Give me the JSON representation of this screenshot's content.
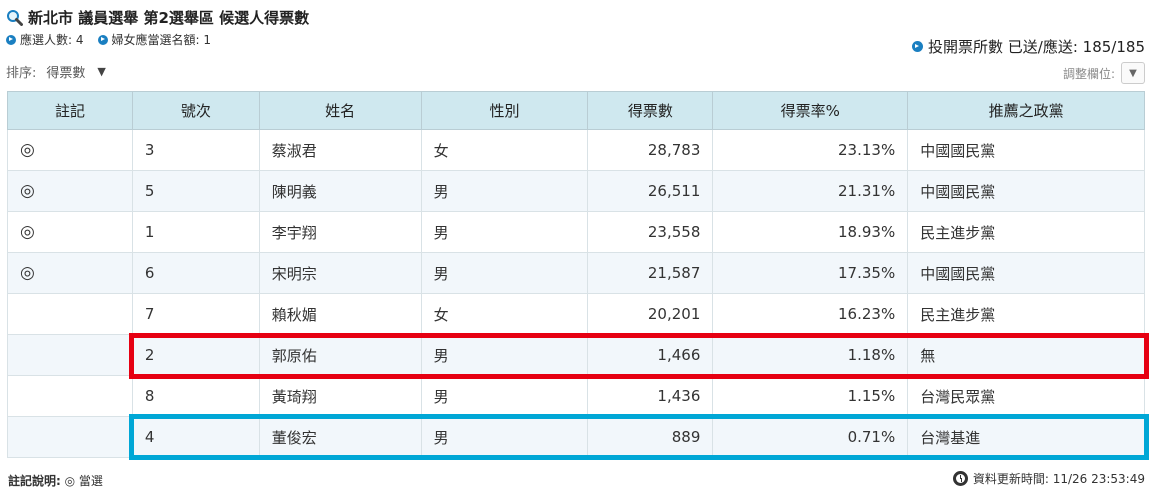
{
  "header": {
    "title": "新北市 議員選舉 第2選舉區 候選人得票數",
    "seats": "應選人數: 4",
    "women_seats": "婦女應當選名額: 1",
    "stations": "投開票所數 已送/應送: 185/185"
  },
  "controls": {
    "sort_label": "排序:",
    "sort_value": "得票數",
    "sort_arrow": "▼",
    "adjust_label": "調整欄位:",
    "adjust_icon": "▼"
  },
  "table": {
    "columns": [
      "註記",
      "號次",
      "姓名",
      "性別",
      "得票數",
      "得票率%",
      "推薦之政黨"
    ],
    "rows": [
      {
        "mark": "◎",
        "number": "3",
        "name": "蔡淑君",
        "gender": "女",
        "votes": "28,783",
        "rate": "23.13%",
        "party": "中國國民黨"
      },
      {
        "mark": "◎",
        "number": "5",
        "name": "陳明義",
        "gender": "男",
        "votes": "26,511",
        "rate": "21.31%",
        "party": "中國國民黨"
      },
      {
        "mark": "◎",
        "number": "1",
        "name": "李宇翔",
        "gender": "男",
        "votes": "23,558",
        "rate": "18.93%",
        "party": "民主進步黨"
      },
      {
        "mark": "◎",
        "number": "6",
        "name": "宋明宗",
        "gender": "男",
        "votes": "21,587",
        "rate": "17.35%",
        "party": "中國國民黨"
      },
      {
        "mark": "",
        "number": "7",
        "name": "賴秋媚",
        "gender": "女",
        "votes": "20,201",
        "rate": "16.23%",
        "party": "民主進步黨"
      },
      {
        "mark": "",
        "number": "2",
        "name": "郭原佑",
        "gender": "男",
        "votes": "1,466",
        "rate": "1.18%",
        "party": "無"
      },
      {
        "mark": "",
        "number": "8",
        "name": "黃琦翔",
        "gender": "男",
        "votes": "1,436",
        "rate": "1.15%",
        "party": "台灣民眾黨"
      },
      {
        "mark": "",
        "number": "4",
        "name": "董俊宏",
        "gender": "男",
        "votes": "889",
        "rate": "0.71%",
        "party": "台灣基進"
      }
    ]
  },
  "footer": {
    "legend_label": "註記說明:",
    "legend_text": "◎ 當選",
    "updated": "資料更新時間: 11/26 23:53:49"
  },
  "colors": {
    "header_bg": "#cfe8ef",
    "highlight_red": "#e60012",
    "highlight_blue": "#00a7d6",
    "bullet": "#1a7fc1"
  },
  "icons": {
    "title": "magnifier-icon",
    "bullet": "arrow-bullet-icon",
    "updated": "clock-icon"
  }
}
